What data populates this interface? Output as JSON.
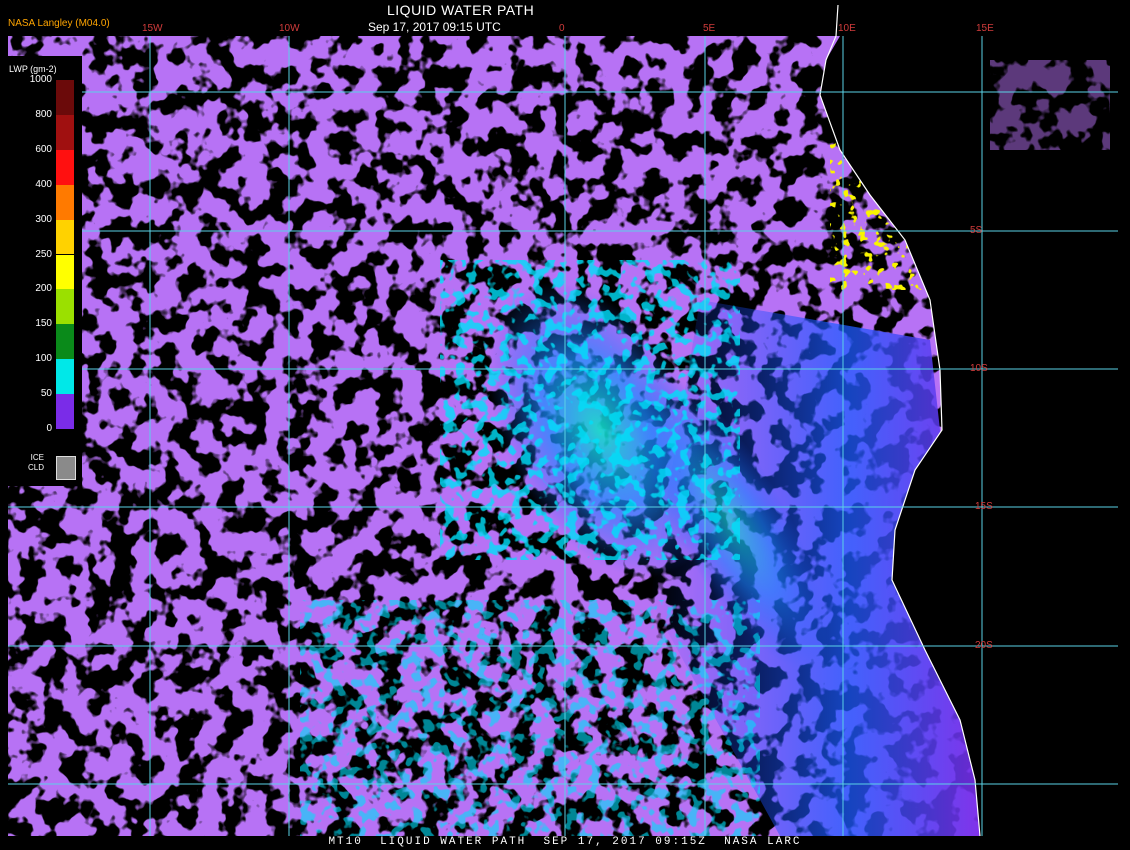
{
  "header": {
    "brand": "NASA Langley (M04.0)",
    "title": "LIQUID WATER PATH",
    "datetime": "Sep 17, 2017 09:15 UTC"
  },
  "footer": {
    "product": "MT10",
    "title": "LIQUID WATER PATH",
    "datetime": "SEP 17, 2017 09:15Z",
    "agency": "NASA LARC"
  },
  "legend": {
    "title": "LWP (gm-2)",
    "levels": [
      {
        "label": "1000",
        "color": "#6b0a0a"
      },
      {
        "label": "800",
        "color": "#a01010"
      },
      {
        "label": "600",
        "color": "#ff1010"
      },
      {
        "label": "400",
        "color": "#ff7a00"
      },
      {
        "label": "300",
        "color": "#ffd200"
      },
      {
        "label": "250",
        "color": "#ffff00"
      },
      {
        "label": "200",
        "color": "#9be000"
      },
      {
        "label": "150",
        "color": "#0a8a1a"
      },
      {
        "label": "100",
        "color": "#00e8e8"
      },
      {
        "label": "50",
        "color": "#0080ff"
      },
      {
        "label": "0",
        "color": "#0010e0"
      }
    ],
    "base_color": "#7a2ce8",
    "ice": {
      "label_1": "ICE",
      "label_2": "CLD",
      "color": "#8a8a8a"
    }
  },
  "map": {
    "lon_labels": [
      "15W",
      "10W",
      "0",
      "5E",
      "10E",
      "15E"
    ],
    "lat_labels": [
      "5S",
      "10S",
      "15S",
      "20S"
    ],
    "grid_color": "#5ad2e6",
    "coast_color": "#ffffff"
  }
}
